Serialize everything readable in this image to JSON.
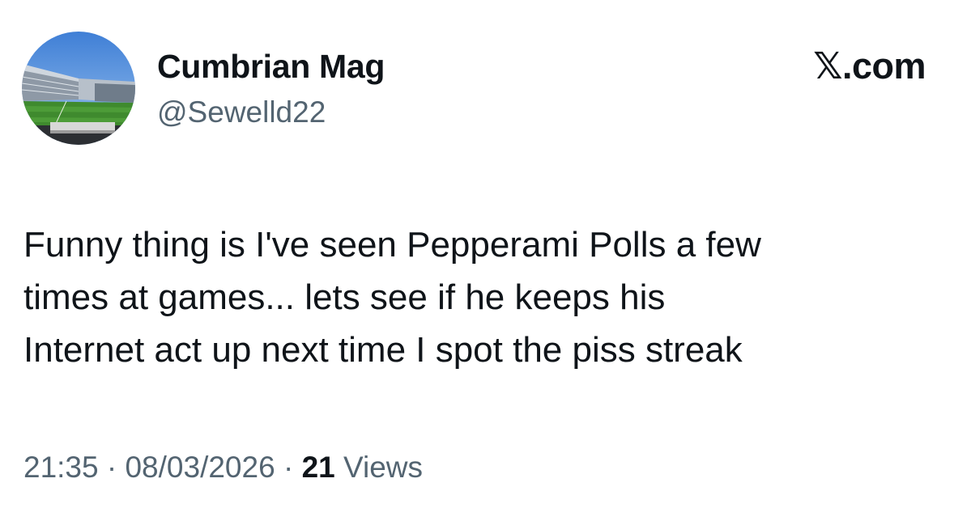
{
  "author": {
    "display_name": "Cumbrian Mag",
    "handle": "@Sewelld22",
    "avatar_icon": "stadium-photo-avatar"
  },
  "brand": {
    "icon": "x-logo-icon",
    "text": "𝕏.com"
  },
  "tweet": {
    "lines": [
      "Funny thing is I've seen Pepperami Polls a few",
      "times at games... lets see if he keeps his",
      "Internet act up next time I spot the piss streak"
    ]
  },
  "meta": {
    "time": "21:35",
    "separator": "·",
    "date": "08/03/2026",
    "view_count": "21",
    "views_label": "Views"
  },
  "colors": {
    "text_primary": "#0f1419",
    "text_secondary": "#536471",
    "background": "#ffffff"
  }
}
